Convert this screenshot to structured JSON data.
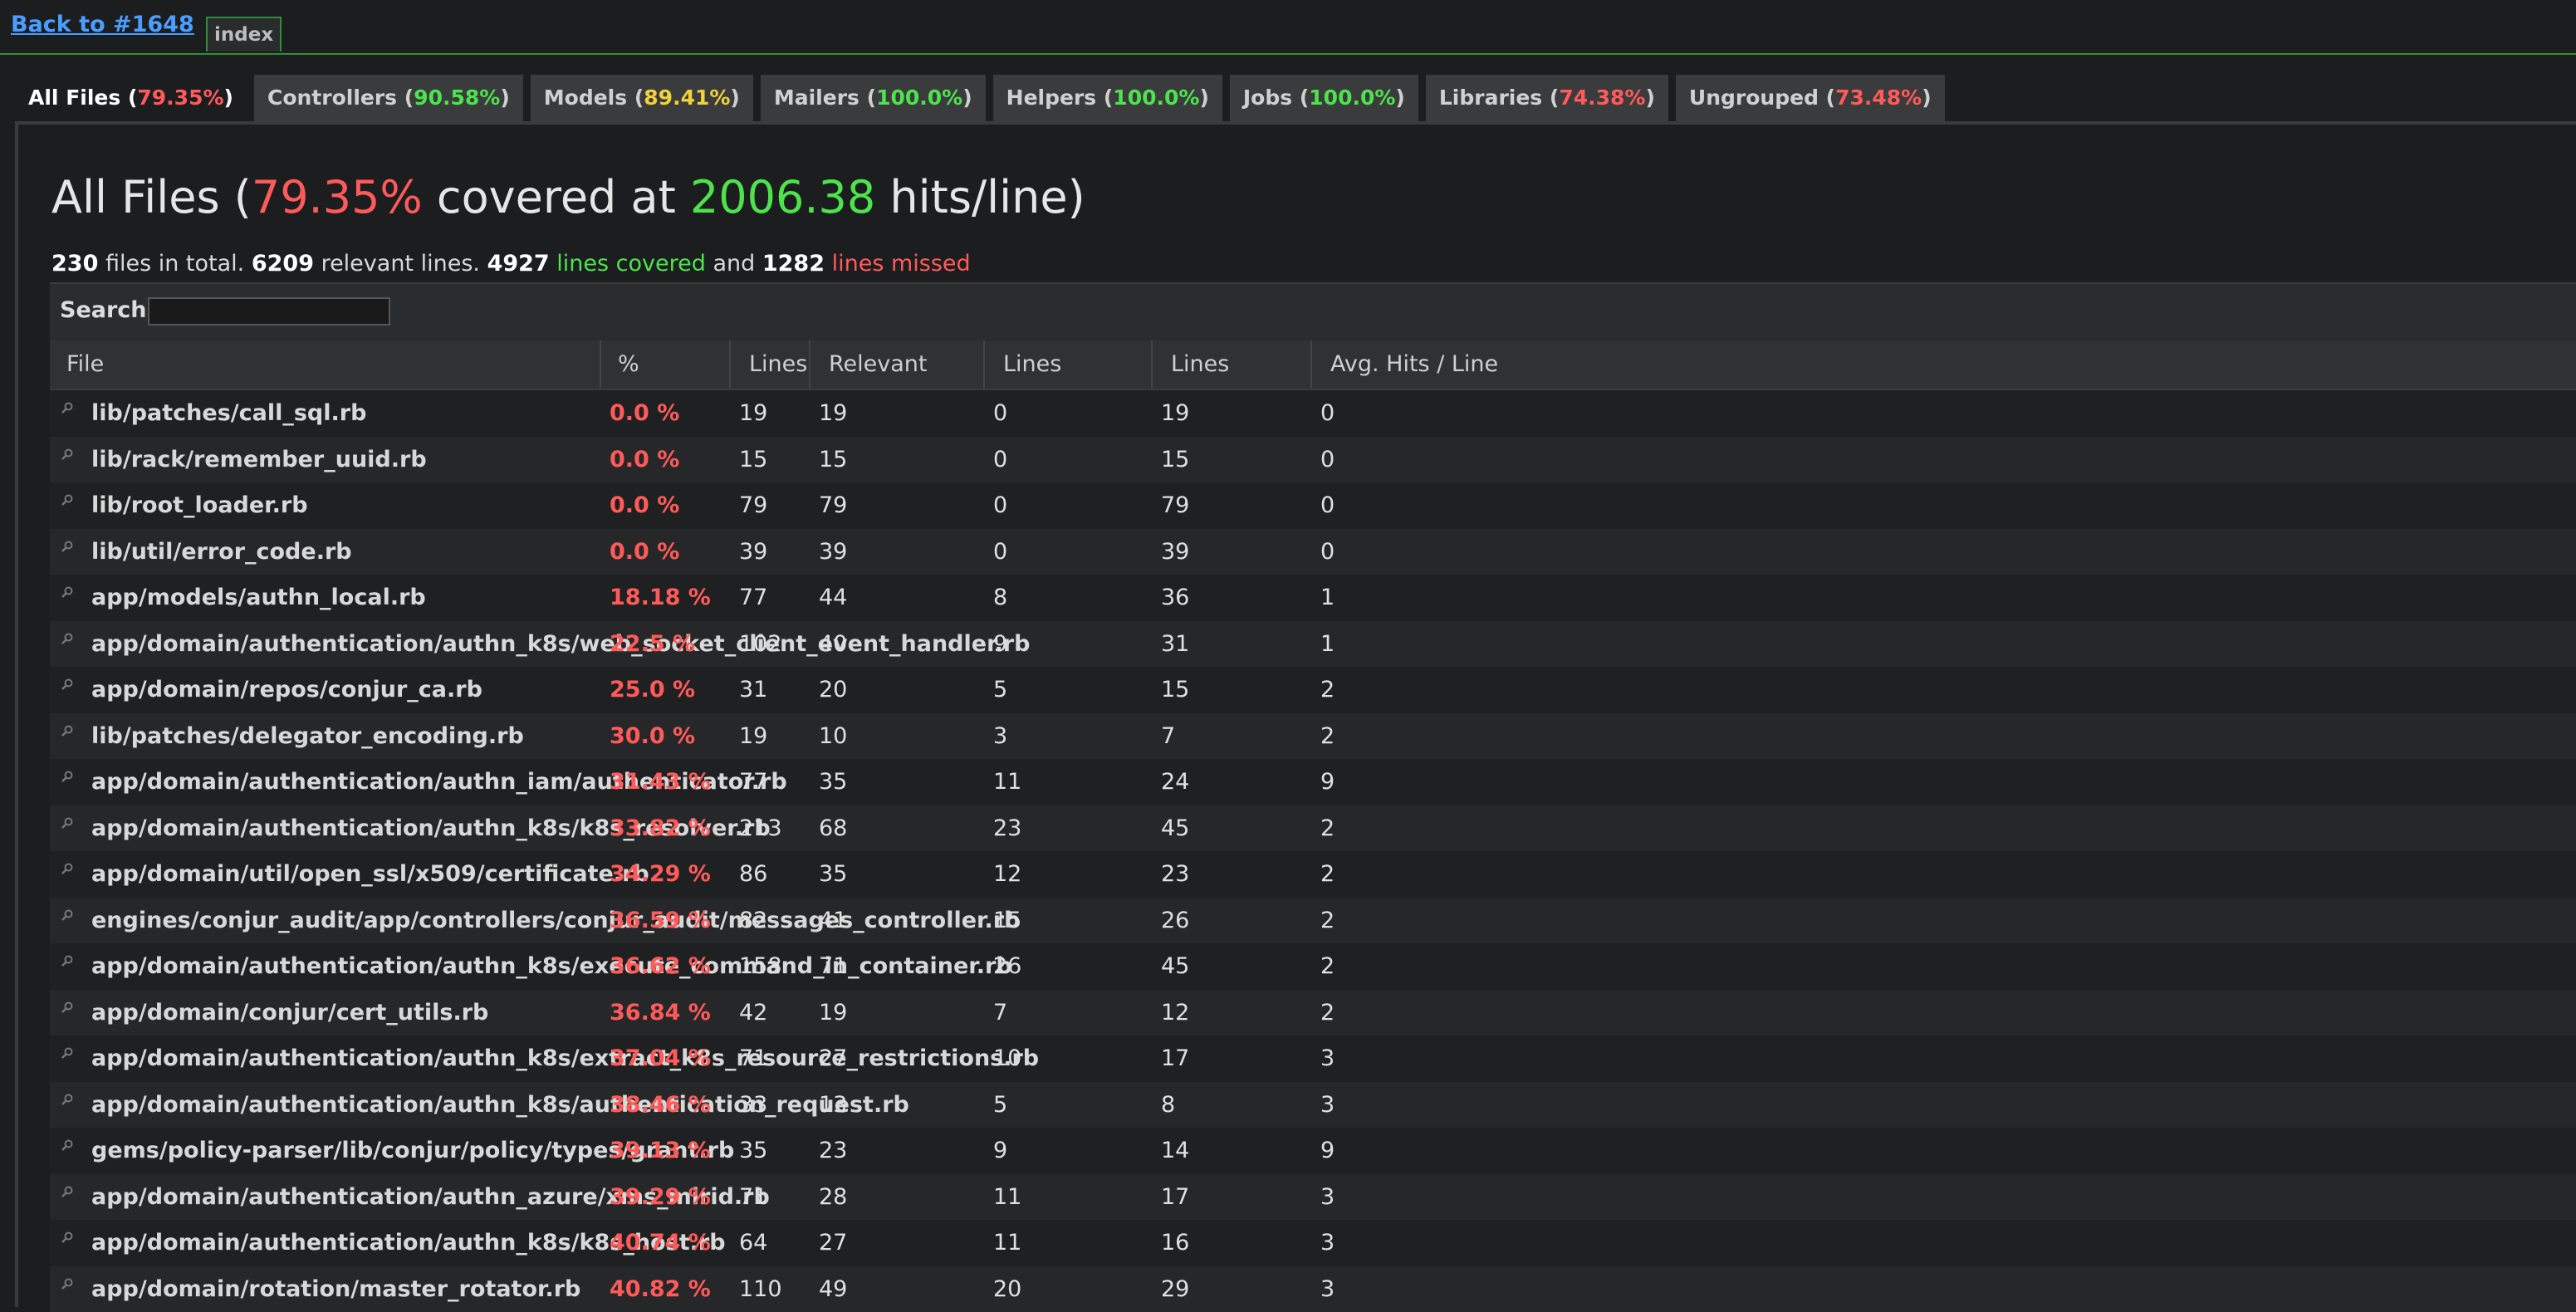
{
  "nav": {
    "back_link": "Back to #1648",
    "index_tab": "index"
  },
  "tabs": [
    {
      "name": "All Files",
      "pct": "79.35%",
      "color": "red",
      "active": true
    },
    {
      "name": "Controllers",
      "pct": "90.58%",
      "color": "green"
    },
    {
      "name": "Models",
      "pct": "89.41%",
      "color": "yellow"
    },
    {
      "name": "Mailers",
      "pct": "100.0%",
      "color": "green"
    },
    {
      "name": "Helpers",
      "pct": "100.0%",
      "color": "green"
    },
    {
      "name": "Jobs",
      "pct": "100.0%",
      "color": "green"
    },
    {
      "name": "Libraries",
      "pct": "74.38%",
      "color": "red"
    },
    {
      "name": "Ungrouped",
      "pct": "73.48%",
      "color": "red"
    }
  ],
  "heading": {
    "prefix": "All Files (",
    "pct": "79.35%",
    "middle": " covered at ",
    "hits": "2006.38",
    "suffix": " hits/line)"
  },
  "summary": {
    "files": "230",
    "files_text": " files in total. ",
    "relevant": "6209",
    "relevant_text": " relevant lines. ",
    "covered": "4927",
    "covered_text": " lines covered",
    "and_text": " and ",
    "missed": "1282",
    "missed_text": " lines missed"
  },
  "search": {
    "label": "Search:",
    "value": ""
  },
  "columns": [
    "File",
    "% covered",
    "Lines",
    "Relevant Lines",
    "Lines covered",
    "Lines missed",
    "Avg. Hits / Line"
  ],
  "rows": [
    {
      "file": "lib/patches/call_sql.rb",
      "pct": "0.0 %",
      "lines": "19",
      "relevant": "19",
      "covered": "0",
      "missed": "19",
      "avg": "0"
    },
    {
      "file": "lib/rack/remember_uuid.rb",
      "pct": "0.0 %",
      "lines": "15",
      "relevant": "15",
      "covered": "0",
      "missed": "15",
      "avg": "0"
    },
    {
      "file": "lib/root_loader.rb",
      "pct": "0.0 %",
      "lines": "79",
      "relevant": "79",
      "covered": "0",
      "missed": "79",
      "avg": "0"
    },
    {
      "file": "lib/util/error_code.rb",
      "pct": "0.0 %",
      "lines": "39",
      "relevant": "39",
      "covered": "0",
      "missed": "39",
      "avg": "0"
    },
    {
      "file": "app/models/authn_local.rb",
      "pct": "18.18 %",
      "lines": "77",
      "relevant": "44",
      "covered": "8",
      "missed": "36",
      "avg": "1"
    },
    {
      "file": "app/domain/authentication/authn_k8s/web_socket_client_event_handler.rb",
      "pct": "22.5 %",
      "lines": "102",
      "relevant": "40",
      "covered": "9",
      "missed": "31",
      "avg": "1"
    },
    {
      "file": "app/domain/repos/conjur_ca.rb",
      "pct": "25.0 %",
      "lines": "31",
      "relevant": "20",
      "covered": "5",
      "missed": "15",
      "avg": "2"
    },
    {
      "file": "lib/patches/delegator_encoding.rb",
      "pct": "30.0 %",
      "lines": "19",
      "relevant": "10",
      "covered": "3",
      "missed": "7",
      "avg": "2"
    },
    {
      "file": "app/domain/authentication/authn_iam/authenticator.rb",
      "pct": "31.43 %",
      "lines": "77",
      "relevant": "35",
      "covered": "11",
      "missed": "24",
      "avg": "9"
    },
    {
      "file": "app/domain/authentication/authn_k8s/k8s_resolver.rb",
      "pct": "33.82 %",
      "lines": "213",
      "relevant": "68",
      "covered": "23",
      "missed": "45",
      "avg": "2"
    },
    {
      "file": "app/domain/util/open_ssl/x509/certificate.rb",
      "pct": "34.29 %",
      "lines": "86",
      "relevant": "35",
      "covered": "12",
      "missed": "23",
      "avg": "2"
    },
    {
      "file": "engines/conjur_audit/app/controllers/conjur_audit/messages_controller.rb",
      "pct": "36.59 %",
      "lines": "82",
      "relevant": "41",
      "covered": "15",
      "missed": "26",
      "avg": "2"
    },
    {
      "file": "app/domain/authentication/authn_k8s/execute_command_in_container.rb",
      "pct": "36.62 %",
      "lines": "158",
      "relevant": "71",
      "covered": "26",
      "missed": "45",
      "avg": "2"
    },
    {
      "file": "app/domain/conjur/cert_utils.rb",
      "pct": "36.84 %",
      "lines": "42",
      "relevant": "19",
      "covered": "7",
      "missed": "12",
      "avg": "2"
    },
    {
      "file": "app/domain/authentication/authn_k8s/extract_k8s_resource_restrictions.rb",
      "pct": "37.04 %",
      "lines": "71",
      "relevant": "27",
      "covered": "10",
      "missed": "17",
      "avg": "3"
    },
    {
      "file": "app/domain/authentication/authn_k8s/authentication_request.rb",
      "pct": "38.46 %",
      "lines": "33",
      "relevant": "13",
      "covered": "5",
      "missed": "8",
      "avg": "3"
    },
    {
      "file": "gems/policy-parser/lib/conjur/policy/types/grant.rb",
      "pct": "39.13 %",
      "lines": "35",
      "relevant": "23",
      "covered": "9",
      "missed": "14",
      "avg": "9"
    },
    {
      "file": "app/domain/authentication/authn_azure/xms_mirid.rb",
      "pct": "39.29 %",
      "lines": "71",
      "relevant": "28",
      "covered": "11",
      "missed": "17",
      "avg": "3"
    },
    {
      "file": "app/domain/authentication/authn_k8s/k8s_host.rb",
      "pct": "40.74 %",
      "lines": "64",
      "relevant": "27",
      "covered": "11",
      "missed": "16",
      "avg": "3"
    },
    {
      "file": "app/domain/rotation/master_rotator.rb",
      "pct": "40.82 %",
      "lines": "110",
      "relevant": "49",
      "covered": "20",
      "missed": "29",
      "avg": "3"
    }
  ]
}
